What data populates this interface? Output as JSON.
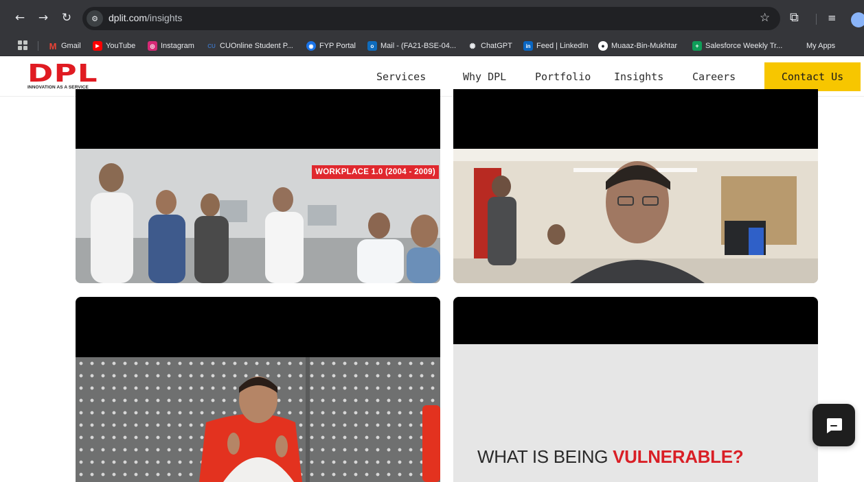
{
  "browser": {
    "url_domain": "dplit.com",
    "url_path": "/insights",
    "bookmarks": [
      {
        "label": "Gmail",
        "icon": "gmail-icon",
        "color": "#ea4335"
      },
      {
        "label": "YouTube",
        "icon": "youtube-icon",
        "color": "#ff0000"
      },
      {
        "label": "Instagram",
        "icon": "instagram-icon",
        "color": "#d62976"
      },
      {
        "label": "CUOnline Student P...",
        "icon": "cuonline-icon",
        "color": "#3c6eb4"
      },
      {
        "label": "FYP Portal",
        "icon": "fyp-portal-icon",
        "color": "#1a73e8"
      },
      {
        "label": "Mail - (FA21-BSE-04...",
        "icon": "outlook-icon",
        "color": "#0f6cbd"
      },
      {
        "label": "ChatGPT",
        "icon": "chatgpt-icon",
        "color": "#10a37f"
      },
      {
        "label": "Feed | LinkedIn",
        "icon": "linkedin-icon",
        "color": "#0a66c2"
      },
      {
        "label": "Muaaz-Bin-Mukhtar",
        "icon": "github-icon",
        "color": "#ffffff"
      },
      {
        "label": "Salesforce Weekly Tr...",
        "icon": "sheets-icon",
        "color": "#0f9d58"
      },
      {
        "label": "My Apps",
        "icon": "microsoft-icon",
        "color": "#f25022"
      }
    ]
  },
  "site": {
    "logo_text": "DPL",
    "logo_tagline": "INNOVATION AS A SERVICE",
    "nav": [
      "Services",
      "Why DPL",
      "Portfolio",
      "Insights",
      "Careers"
    ],
    "cta_label": "Contact Us",
    "brand_red": "#e01b22",
    "cta_color": "#f7c600"
  },
  "cards": {
    "card1_badge": "WORKPLACE 1.0 (2004 - 2009)",
    "card4_title_prefix": "WHAT IS BEING ",
    "card4_title_highlight": "VULNERABLE?"
  }
}
